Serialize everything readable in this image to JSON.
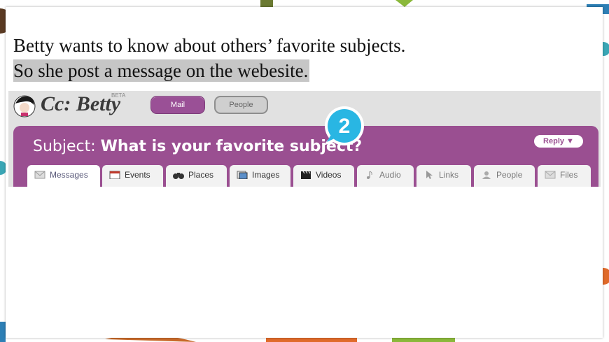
{
  "slide": {
    "line1": "Betty wants to know about others’ favorite subjects.",
    "line2": "So she post a message on the webesite."
  },
  "app": {
    "logo_text": "Cc: Betty",
    "logo_badge": "BETA",
    "nav": {
      "mail_label": "Mail",
      "people_label": "People"
    },
    "subject_prefix": "Subject:",
    "subject_text": "What is your favorite subject?",
    "reply_label": "Reply ▼",
    "step_number": "2",
    "tabs": [
      {
        "label": "Messages",
        "icon": "envelope-icon"
      },
      {
        "label": "Events",
        "icon": "calendar-icon"
      },
      {
        "label": "Places",
        "icon": "binoculars-icon"
      },
      {
        "label": "Images",
        "icon": "image-icon"
      },
      {
        "label": "Videos",
        "icon": "clapper-icon"
      },
      {
        "label": "Audio",
        "icon": "music-note-icon"
      },
      {
        "label": "Links",
        "icon": "cursor-icon"
      },
      {
        "label": "People",
        "icon": "person-icon"
      },
      {
        "label": "Files",
        "icon": "envelope-icon"
      }
    ]
  },
  "colors": {
    "accent": "#9a4f91",
    "badge": "#29b6e3"
  }
}
